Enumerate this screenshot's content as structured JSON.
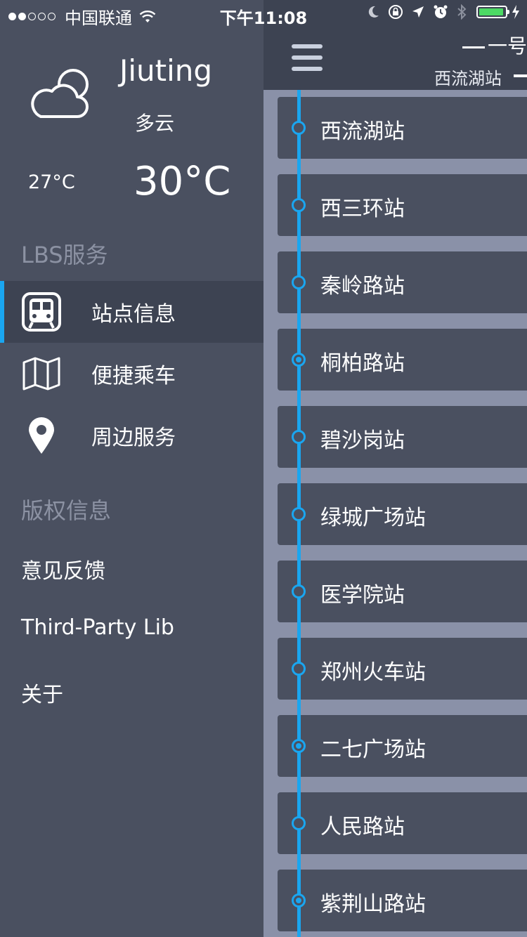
{
  "status_bar": {
    "carrier": "中国联通",
    "time": "下午11:08",
    "signal_dots_filled": 2,
    "signal_dots_total": 5,
    "battery_level": 0.95,
    "battery_color": "#4cd964",
    "icons": [
      "wifi-icon",
      "moon-icon",
      "rotation-lock-icon",
      "location-arrow-icon",
      "alarm-icon",
      "bluetooth-icon",
      "battery-icon",
      "charging-bolt-icon"
    ]
  },
  "weather": {
    "city": "Jiuting",
    "condition": "多云",
    "temp_low": "27°C",
    "temp_high": "30°C",
    "icon": "partly-cloudy-icon"
  },
  "drawer": {
    "lbs_title": "LBS服务",
    "lbs_items": [
      {
        "label": "站点信息",
        "icon": "train-icon",
        "active": true
      },
      {
        "label": "便捷乘车",
        "icon": "map-icon",
        "active": false
      },
      {
        "label": "周边服务",
        "icon": "location-pin-icon",
        "active": false
      }
    ],
    "copyright_title": "版权信息",
    "copyright_items": [
      {
        "label": "意见反馈"
      },
      {
        "label": "Third-Party Lib"
      },
      {
        "label": "关于"
      }
    ]
  },
  "main": {
    "line_title": "一号",
    "from_station": "西流湖站",
    "stations": [
      {
        "name": "西流湖站"
      },
      {
        "name": "西三环站"
      },
      {
        "name": "秦岭路站"
      },
      {
        "name": "桐柏路站"
      },
      {
        "name": "碧沙岗站"
      },
      {
        "name": "绿城广场站"
      },
      {
        "name": "医学院站"
      },
      {
        "name": "郑州火车站"
      },
      {
        "name": "二七广场站"
      },
      {
        "name": "人民路站"
      },
      {
        "name": "紫荆山路站"
      }
    ]
  },
  "colors": {
    "accent": "#1aa6f0",
    "panel": "#4a5060",
    "navbar": "#3d4352",
    "list_bg": "#8a91a8",
    "muted_text": "#8c92a3"
  }
}
